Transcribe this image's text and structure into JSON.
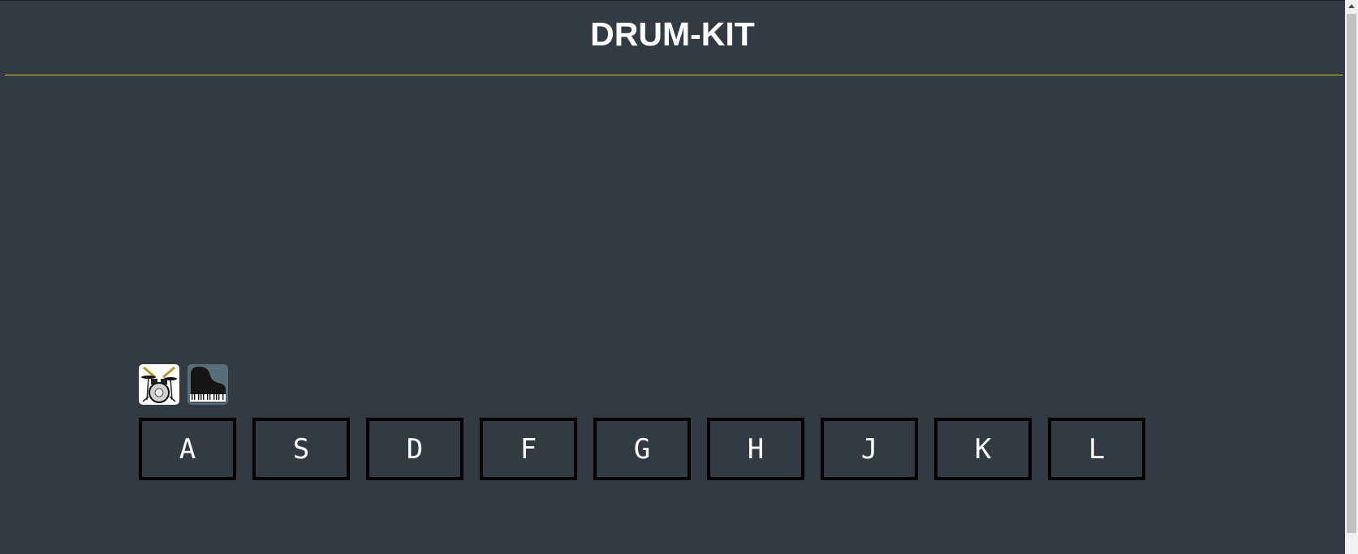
{
  "header": {
    "title": "DRUM-KIT"
  },
  "instruments": [
    {
      "name": "drum-kit-icon"
    },
    {
      "name": "piano-icon"
    }
  ],
  "keys": [
    {
      "label": "A"
    },
    {
      "label": "S"
    },
    {
      "label": "D"
    },
    {
      "label": "F"
    },
    {
      "label": "G"
    },
    {
      "label": "H"
    },
    {
      "label": "J"
    },
    {
      "label": "K"
    },
    {
      "label": "L"
    }
  ],
  "colors": {
    "background": "#323a43",
    "divider": "#c9c23a",
    "key_border": "#000000",
    "text": "#ffffff"
  }
}
